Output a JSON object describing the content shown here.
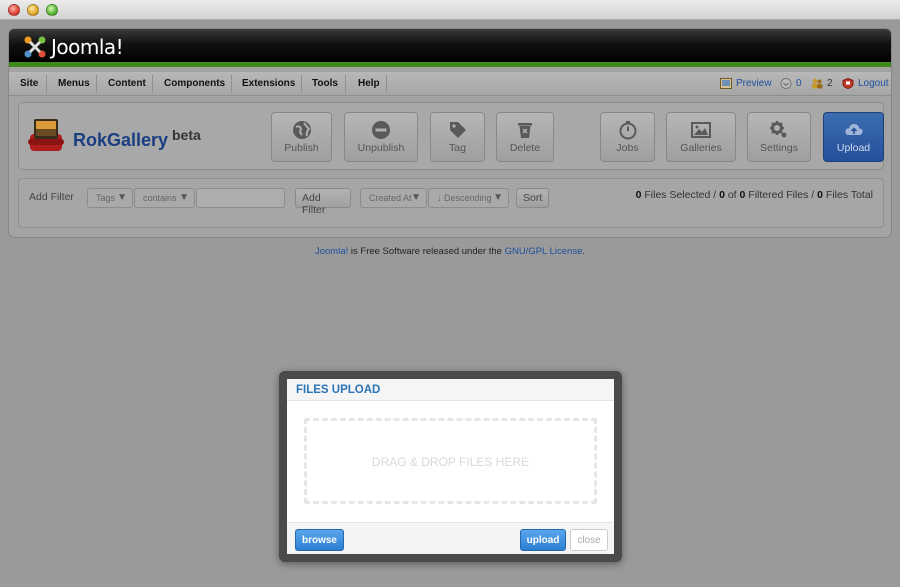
{
  "header": {
    "logo_text": "Joomla!"
  },
  "menu": {
    "items": [
      "Site",
      "Menus",
      "Content",
      "Components",
      "Extensions",
      "Tools",
      "Help"
    ]
  },
  "status": {
    "preview_label": "Preview",
    "messages_count": "0",
    "users_count": "2",
    "logout_label": "Logout"
  },
  "app": {
    "title": "RokGallery",
    "badge": "beta"
  },
  "toolbar": {
    "buttons": [
      {
        "label": "Publish",
        "icon": "globe-icon"
      },
      {
        "label": "Unpublish",
        "icon": "minus-circle-icon"
      },
      {
        "label": "Tag",
        "icon": "tag-icon"
      },
      {
        "label": "Delete",
        "icon": "trash-icon"
      },
      {
        "label": "Jobs",
        "icon": "stopwatch-icon"
      },
      {
        "label": "Galleries",
        "icon": "picture-icon"
      },
      {
        "label": "Settings",
        "icon": "gear-icon"
      },
      {
        "label": "Upload",
        "icon": "cloud-upload-icon"
      }
    ]
  },
  "filter": {
    "label": "Add Filter",
    "field_select": "Tags",
    "operator_select": "contains",
    "input_value": "",
    "add_button": "Add Filter",
    "sort_field_select": "Created At",
    "sort_dir_select": "↓ Descending",
    "sort_button": "Sort",
    "selected_count": "0",
    "selected_label": "Files Selected /",
    "filtered_count_a": "0",
    "filtered_of": "of",
    "filtered_count_b": "0",
    "filtered_label": "Filtered Files /",
    "total_count": "0",
    "total_label": "Files Total"
  },
  "footer": {
    "joomla_link": "Joomla!",
    "text": " is Free Software released under the ",
    "license_link": "GNU/GPL License",
    "end": "."
  },
  "modal": {
    "title": "FILES UPLOAD",
    "dropzone_text": "DRAG & DROP FILES HERE",
    "browse_button": "browse",
    "upload_button": "upload",
    "close_button": "close"
  },
  "colors": {
    "header_green": "#3d8a1b",
    "upload_blue": "#2b5ba3",
    "modal_title_blue": "#2a74b8",
    "link_blue": "#1d4f9e"
  }
}
